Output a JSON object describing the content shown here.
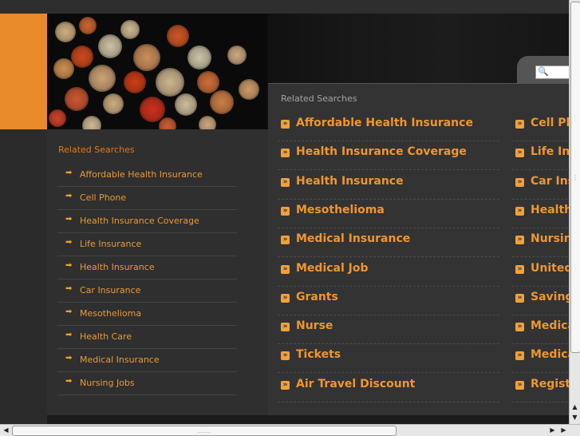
{
  "sidebar": {
    "title": "Related Searches",
    "items": [
      "Affordable Health Insurance",
      "Cell Phone",
      "Health Insurance Coverage",
      "Life Insurance",
      "Health Insurance",
      "Car Insurance",
      "Mesothelioma",
      "Health Care",
      "Medical Insurance",
      "Nursing Jobs"
    ]
  },
  "main": {
    "title": "Related Searches",
    "column1": [
      "Affordable Health Insurance",
      "Health Insurance Coverage",
      "Health Insurance",
      "Mesothelioma",
      "Medical Insurance",
      "Medical Job",
      "Grants",
      "Nurse",
      "Tickets",
      "Air Travel Discount"
    ],
    "column2": [
      "Cell Ph",
      "Life Ins",
      "Car Ins",
      "Health",
      "Nursing",
      "United",
      "Saving",
      "Medica",
      "Medica",
      "Registe"
    ]
  },
  "colors": {
    "accent": "#e98a2b",
    "link": "#f0962e",
    "background": "#2b2b2b"
  },
  "icons": {
    "search": "search-icon",
    "sidebar_bullet": "arrow-right-icon",
    "main_bullet": "chevron-right-icon"
  }
}
